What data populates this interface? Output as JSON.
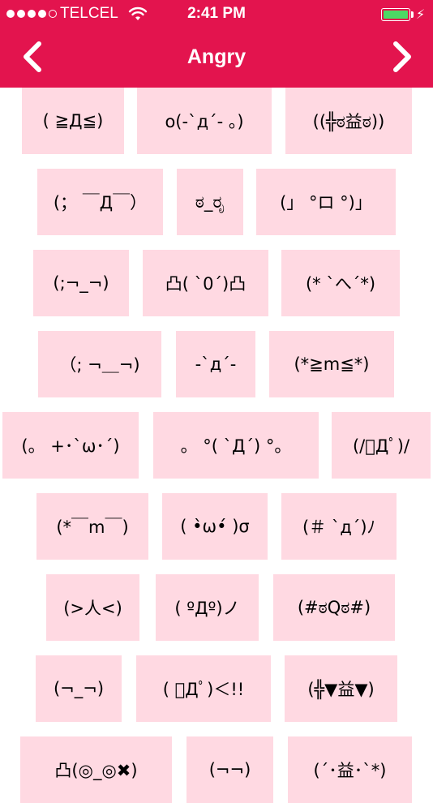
{
  "status_bar": {
    "carrier": "TELCEL",
    "time": "2:41 PM",
    "signal_bars": 4,
    "battery_level": 1.0
  },
  "nav": {
    "title": "Angry",
    "back_icon": "chevron-left-icon",
    "forward_icon": "chevron-right-icon"
  },
  "colors": {
    "header": "#e3144e",
    "tile": "#ffd9e2",
    "battery": "#4cd964"
  },
  "emoticons": [
    [
      "( ≧Д≦)",
      "o(-`д´- 。)",
      "((╬ಠ益ಠ))"
    ],
    [
      "(； ￣Д￣）",
      "ಠ_ರೃ",
      "(」 °ロ °)」"
    ],
    [
      "(;¬_¬)",
      "凸( `0´)凸",
      "(* `へ´*)"
    ],
    [
      "（; ¬＿¬)",
      "-`д´-",
      "(*≧m≦*)"
    ],
    [
      "(。 +･`ω･´)",
      "。 °( `Д´) °。",
      "(/ﾟДﾟ)/"
    ],
    [
      "(*￣m￣)",
      "( •̀ω•́ )σ",
      "(＃ `д´)ﾉ"
    ],
    [
      "(>人<)",
      "( ºДº)ノ",
      "(#ಠQಠ#)"
    ],
    [
      "(¬_¬)",
      "( ﾟДﾟ)＜!!",
      "(╬▼益▼)"
    ],
    [
      "凸(◎_◎✖)",
      "(¬¬)",
      "(´･益･`*)"
    ]
  ]
}
